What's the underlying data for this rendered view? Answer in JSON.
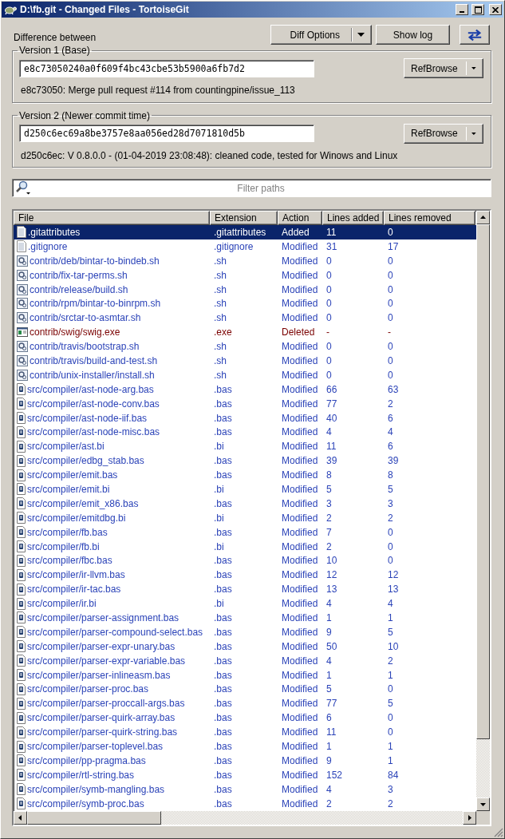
{
  "window": {
    "title": "D:\\fb.git - Changed Files - TortoiseGit"
  },
  "header": {
    "label": "Difference between",
    "buttons": [
      {
        "label": "Diff Options",
        "kind": "split"
      },
      {
        "label": "Show log",
        "kind": "plain"
      }
    ]
  },
  "versions": [
    {
      "legend": "Version 1 (Base)",
      "value": "e8c73050240a0f609f4bc43cbe53b5900a6fb7d2",
      "button": "RefBrowse",
      "description": "e8c73050: Merge pull request #114 from countingpine/issue_113"
    },
    {
      "legend": "Version 2 (Newer commit time)",
      "value": "d250c6ec69a8be3757e8aa056ed28d7071810d5b",
      "button": "RefBrowse",
      "description": "d250c6ec: V 0.8.0.0 - (01-04-2019 23:08:48):  cleaned code, tested for Winows and Linux"
    }
  ],
  "filter": {
    "placeholder": "Filter paths"
  },
  "table": {
    "columns": [
      "File",
      "Extension",
      "Action",
      "Lines added",
      "Lines removed"
    ],
    "rows": [
      {
        "file": ".gitattributes",
        "extension": ".gitattributes",
        "action": "Added",
        "added": "11",
        "removed": "0",
        "kind": "text",
        "color": "#ffffff",
        "selected": true
      },
      {
        "file": ".gitignore",
        "extension": ".gitignore",
        "action": "Modified",
        "added": "31",
        "removed": "17",
        "kind": "text",
        "color": "#2b43b8",
        "selected": false
      },
      {
        "file": "contrib/deb/bintar-to-bindeb.sh",
        "extension": ".sh",
        "action": "Modified",
        "added": "0",
        "removed": "0",
        "kind": "script",
        "color": "#2b43b8",
        "selected": false
      },
      {
        "file": "contrib/fix-tar-perms.sh",
        "extension": ".sh",
        "action": "Modified",
        "added": "0",
        "removed": "0",
        "kind": "script",
        "color": "#2b43b8",
        "selected": false
      },
      {
        "file": "contrib/release/build.sh",
        "extension": ".sh",
        "action": "Modified",
        "added": "0",
        "removed": "0",
        "kind": "script",
        "color": "#2b43b8",
        "selected": false
      },
      {
        "file": "contrib/rpm/bintar-to-binrpm.sh",
        "extension": ".sh",
        "action": "Modified",
        "added": "0",
        "removed": "0",
        "kind": "script",
        "color": "#2b43b8",
        "selected": false
      },
      {
        "file": "contrib/srctar-to-asmtar.sh",
        "extension": ".sh",
        "action": "Modified",
        "added": "0",
        "removed": "0",
        "kind": "script",
        "color": "#2b43b8",
        "selected": false
      },
      {
        "file": "contrib/swig/swig.exe",
        "extension": ".exe",
        "action": "Deleted",
        "added": "-",
        "removed": "-",
        "kind": "exe",
        "color": "#7a0000",
        "selected": false
      },
      {
        "file": "contrib/travis/bootstrap.sh",
        "extension": ".sh",
        "action": "Modified",
        "added": "0",
        "removed": "0",
        "kind": "script",
        "color": "#2b43b8",
        "selected": false
      },
      {
        "file": "contrib/travis/build-and-test.sh",
        "extension": ".sh",
        "action": "Modified",
        "added": "0",
        "removed": "0",
        "kind": "script",
        "color": "#2b43b8",
        "selected": false
      },
      {
        "file": "contrib/unix-installer/install.sh",
        "extension": ".sh",
        "action": "Modified",
        "added": "0",
        "removed": "0",
        "kind": "script",
        "color": "#2b43b8",
        "selected": false
      },
      {
        "file": "src/compiler/ast-node-arg.bas",
        "extension": ".bas",
        "action": "Modified",
        "added": "66",
        "removed": "63",
        "kind": "source",
        "color": "#2b43b8",
        "selected": false
      },
      {
        "file": "src/compiler/ast-node-conv.bas",
        "extension": ".bas",
        "action": "Modified",
        "added": "77",
        "removed": "2",
        "kind": "source",
        "color": "#2b43b8",
        "selected": false
      },
      {
        "file": "src/compiler/ast-node-iif.bas",
        "extension": ".bas",
        "action": "Modified",
        "added": "40",
        "removed": "6",
        "kind": "source",
        "color": "#2b43b8",
        "selected": false
      },
      {
        "file": "src/compiler/ast-node-misc.bas",
        "extension": ".bas",
        "action": "Modified",
        "added": "4",
        "removed": "4",
        "kind": "source",
        "color": "#2b43b8",
        "selected": false
      },
      {
        "file": "src/compiler/ast.bi",
        "extension": ".bi",
        "action": "Modified",
        "added": "11",
        "removed": "6",
        "kind": "source",
        "color": "#2b43b8",
        "selected": false
      },
      {
        "file": "src/compiler/edbg_stab.bas",
        "extension": ".bas",
        "action": "Modified",
        "added": "39",
        "removed": "39",
        "kind": "source",
        "color": "#2b43b8",
        "selected": false
      },
      {
        "file": "src/compiler/emit.bas",
        "extension": ".bas",
        "action": "Modified",
        "added": "8",
        "removed": "8",
        "kind": "source",
        "color": "#2b43b8",
        "selected": false
      },
      {
        "file": "src/compiler/emit.bi",
        "extension": ".bi",
        "action": "Modified",
        "added": "5",
        "removed": "5",
        "kind": "source",
        "color": "#2b43b8",
        "selected": false
      },
      {
        "file": "src/compiler/emit_x86.bas",
        "extension": ".bas",
        "action": "Modified",
        "added": "3",
        "removed": "3",
        "kind": "source",
        "color": "#2b43b8",
        "selected": false
      },
      {
        "file": "src/compiler/emitdbg.bi",
        "extension": ".bi",
        "action": "Modified",
        "added": "2",
        "removed": "2",
        "kind": "source",
        "color": "#2b43b8",
        "selected": false
      },
      {
        "file": "src/compiler/fb.bas",
        "extension": ".bas",
        "action": "Modified",
        "added": "7",
        "removed": "0",
        "kind": "source",
        "color": "#2b43b8",
        "selected": false
      },
      {
        "file": "src/compiler/fb.bi",
        "extension": ".bi",
        "action": "Modified",
        "added": "2",
        "removed": "0",
        "kind": "source",
        "color": "#2b43b8",
        "selected": false
      },
      {
        "file": "src/compiler/fbc.bas",
        "extension": ".bas",
        "action": "Modified",
        "added": "10",
        "removed": "0",
        "kind": "source",
        "color": "#2b43b8",
        "selected": false
      },
      {
        "file": "src/compiler/ir-llvm.bas",
        "extension": ".bas",
        "action": "Modified",
        "added": "12",
        "removed": "12",
        "kind": "source",
        "color": "#2b43b8",
        "selected": false
      },
      {
        "file": "src/compiler/ir-tac.bas",
        "extension": ".bas",
        "action": "Modified",
        "added": "13",
        "removed": "13",
        "kind": "source",
        "color": "#2b43b8",
        "selected": false
      },
      {
        "file": "src/compiler/ir.bi",
        "extension": ".bi",
        "action": "Modified",
        "added": "4",
        "removed": "4",
        "kind": "source",
        "color": "#2b43b8",
        "selected": false
      },
      {
        "file": "src/compiler/parser-assignment.bas",
        "extension": ".bas",
        "action": "Modified",
        "added": "1",
        "removed": "1",
        "kind": "source",
        "color": "#2b43b8",
        "selected": false
      },
      {
        "file": "src/compiler/parser-compound-select.bas",
        "extension": ".bas",
        "action": "Modified",
        "added": "9",
        "removed": "5",
        "kind": "source",
        "color": "#2b43b8",
        "selected": false
      },
      {
        "file": "src/compiler/parser-expr-unary.bas",
        "extension": ".bas",
        "action": "Modified",
        "added": "50",
        "removed": "10",
        "kind": "source",
        "color": "#2b43b8",
        "selected": false
      },
      {
        "file": "src/compiler/parser-expr-variable.bas",
        "extension": ".bas",
        "action": "Modified",
        "added": "4",
        "removed": "2",
        "kind": "source",
        "color": "#2b43b8",
        "selected": false
      },
      {
        "file": "src/compiler/parser-inlineasm.bas",
        "extension": ".bas",
        "action": "Modified",
        "added": "1",
        "removed": "1",
        "kind": "source",
        "color": "#2b43b8",
        "selected": false
      },
      {
        "file": "src/compiler/parser-proc.bas",
        "extension": ".bas",
        "action": "Modified",
        "added": "5",
        "removed": "0",
        "kind": "source",
        "color": "#2b43b8",
        "selected": false
      },
      {
        "file": "src/compiler/parser-proccall-args.bas",
        "extension": ".bas",
        "action": "Modified",
        "added": "77",
        "removed": "5",
        "kind": "source",
        "color": "#2b43b8",
        "selected": false
      },
      {
        "file": "src/compiler/parser-quirk-array.bas",
        "extension": ".bas",
        "action": "Modified",
        "added": "6",
        "removed": "0",
        "kind": "source",
        "color": "#2b43b8",
        "selected": false
      },
      {
        "file": "src/compiler/parser-quirk-string.bas",
        "extension": ".bas",
        "action": "Modified",
        "added": "11",
        "removed": "0",
        "kind": "source",
        "color": "#2b43b8",
        "selected": false
      },
      {
        "file": "src/compiler/parser-toplevel.bas",
        "extension": ".bas",
        "action": "Modified",
        "added": "1",
        "removed": "1",
        "kind": "source",
        "color": "#2b43b8",
        "selected": false
      },
      {
        "file": "src/compiler/pp-pragma.bas",
        "extension": ".bas",
        "action": "Modified",
        "added": "9",
        "removed": "1",
        "kind": "source",
        "color": "#2b43b8",
        "selected": false
      },
      {
        "file": "src/compiler/rtl-string.bas",
        "extension": ".bas",
        "action": "Modified",
        "added": "152",
        "removed": "84",
        "kind": "source",
        "color": "#2b43b8",
        "selected": false
      },
      {
        "file": "src/compiler/symb-mangling.bas",
        "extension": ".bas",
        "action": "Modified",
        "added": "4",
        "removed": "3",
        "kind": "source",
        "color": "#2b43b8",
        "selected": false
      },
      {
        "file": "src/compiler/symb-proc.bas",
        "extension": ".bas",
        "action": "Modified",
        "added": "2",
        "removed": "2",
        "kind": "source",
        "color": "#2b43b8",
        "selected": false
      }
    ]
  }
}
